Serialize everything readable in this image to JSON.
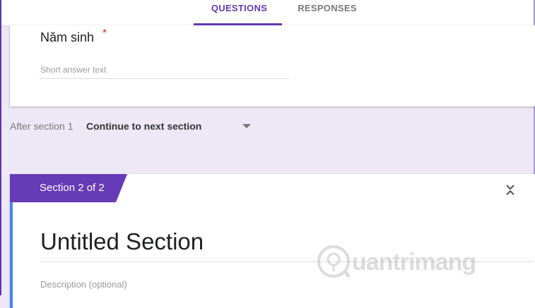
{
  "tabs": [
    {
      "label": "QUESTIONS",
      "active": true
    },
    {
      "label": "RESPONSES",
      "active": false
    }
  ],
  "question": {
    "title": "Năm sinh",
    "required_mark": "*",
    "placeholder": "Short answer text"
  },
  "after_section": {
    "label": "After section 1",
    "value": "Continue to next section"
  },
  "section": {
    "badge": "Section 2 of 2",
    "title": "Untitled Section",
    "description_placeholder": "Description (optional)"
  },
  "watermark": {
    "text": "uantrimang"
  },
  "colors": {
    "accent": "#673ab7",
    "background": "#ede7f6",
    "section_accent": "#4285f4",
    "required": "#d93025"
  },
  "icons": {
    "collapse": "collapse-icon",
    "dropdown": "dropdown-caret-icon",
    "watermark_logo": "lightbulb-logo-icon"
  }
}
